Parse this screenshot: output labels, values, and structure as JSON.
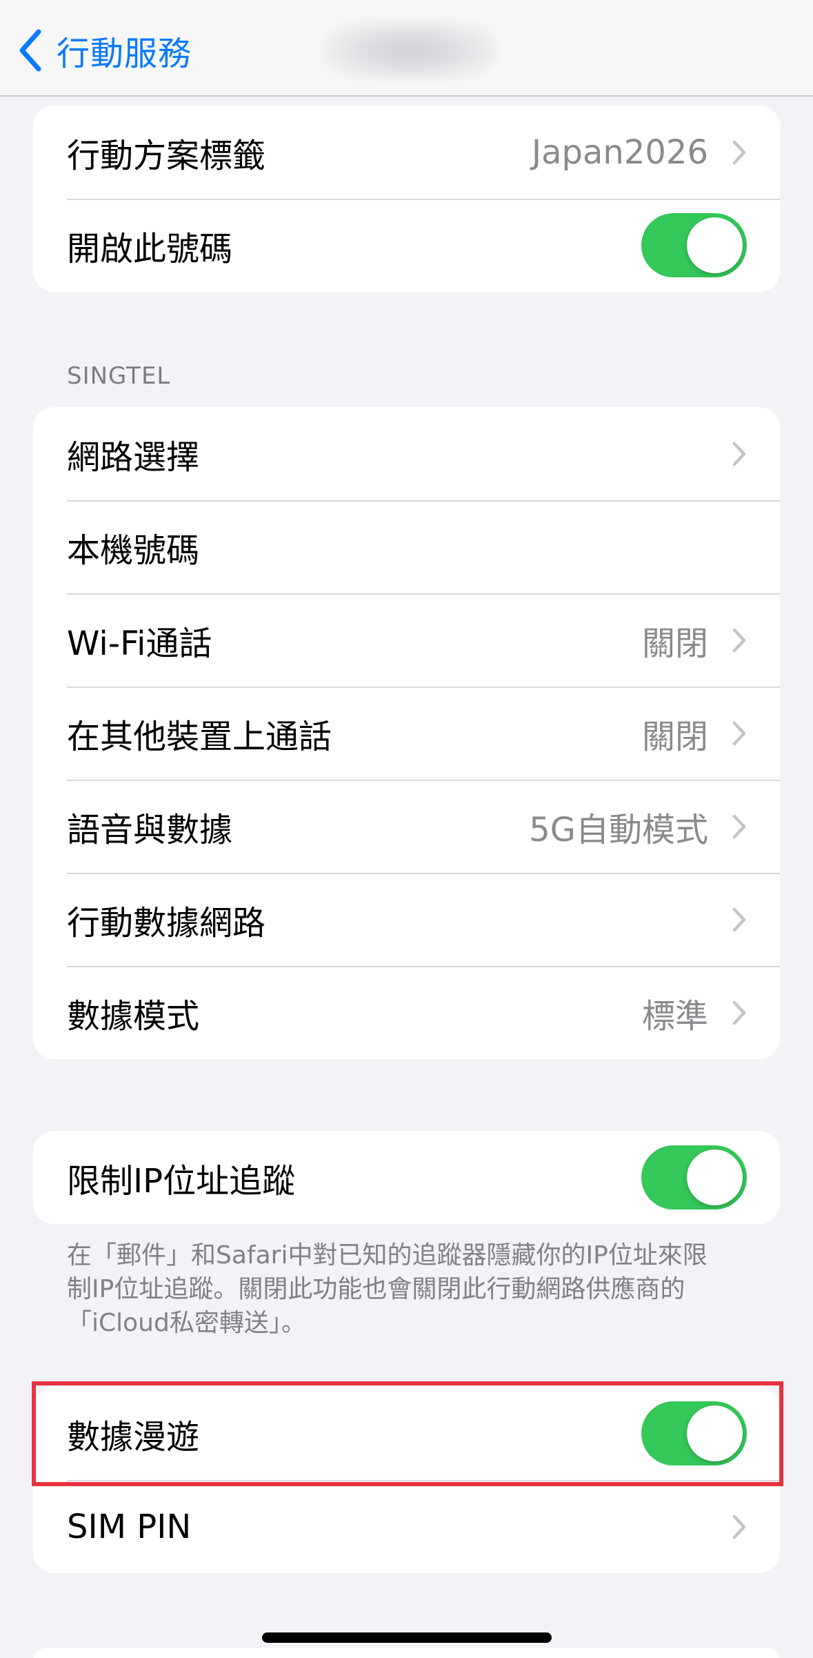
{
  "nav": {
    "back_label": "行動服務",
    "back_icon": "chevron-left-icon",
    "title_obscured": true
  },
  "group1": {
    "rows": [
      {
        "label": "行動方案標籤",
        "value": "Japan2026",
        "accessory": "chevron"
      },
      {
        "label": "開啟此號碼",
        "accessory": "toggle",
        "toggle_on": true
      }
    ]
  },
  "singtel": {
    "header": "SINGTEL",
    "rows": [
      {
        "label": "網路選擇",
        "value": "",
        "accessory": "chevron"
      },
      {
        "label": "本機號碼",
        "value": "",
        "accessory": "none"
      },
      {
        "label": "Wi-Fi通話",
        "value": "關閉",
        "accessory": "chevron"
      },
      {
        "label": "在其他裝置上通話",
        "value": "關閉",
        "accessory": "chevron"
      },
      {
        "label": "語音與數據",
        "value": "5G自動模式",
        "accessory": "chevron"
      },
      {
        "label": "行動數據網路",
        "value": "",
        "accessory": "chevron"
      },
      {
        "label": "數據模式",
        "value": "標準",
        "accessory": "chevron"
      }
    ]
  },
  "privacy": {
    "row": {
      "label": "限制IP位址追蹤",
      "accessory": "toggle",
      "toggle_on": true
    },
    "footnote": "在「郵件」和Safari中對已知的追蹤器隱藏你的IP位址來限制IP位址追蹤。關閉此功能也會關閉此行動網路供應商的「iCloud私密轉送」。"
  },
  "group4": {
    "rows": [
      {
        "label": "數據漫遊",
        "accessory": "toggle",
        "toggle_on": true,
        "highlighted": true
      },
      {
        "label": "SIM PIN",
        "accessory": "chevron"
      }
    ]
  },
  "colors": {
    "accent": "#0a7aff",
    "toggle_on": "#34c759",
    "highlight_border": "#e8333e",
    "background": "#f2f2f7"
  }
}
